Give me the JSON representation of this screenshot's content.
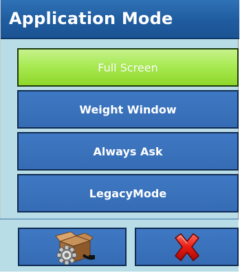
{
  "window": {
    "title": "Application Mode"
  },
  "options": [
    {
      "label": "Full Screen",
      "selected": true
    },
    {
      "label": "Weight Window",
      "selected": false
    },
    {
      "label": "Always Ask",
      "selected": false
    },
    {
      "label": "LegacyMode",
      "selected": false
    }
  ],
  "footer": {
    "settings_icon": "box-with-gear-icon",
    "cancel_icon": "red-x-close-icon"
  },
  "colors": {
    "title_bar": "#1f5c9f",
    "dialog_background": "#b9dde6",
    "option_button": "#3870b9",
    "selected_option": "#a9ea54",
    "cancel_x": "#e01010"
  }
}
